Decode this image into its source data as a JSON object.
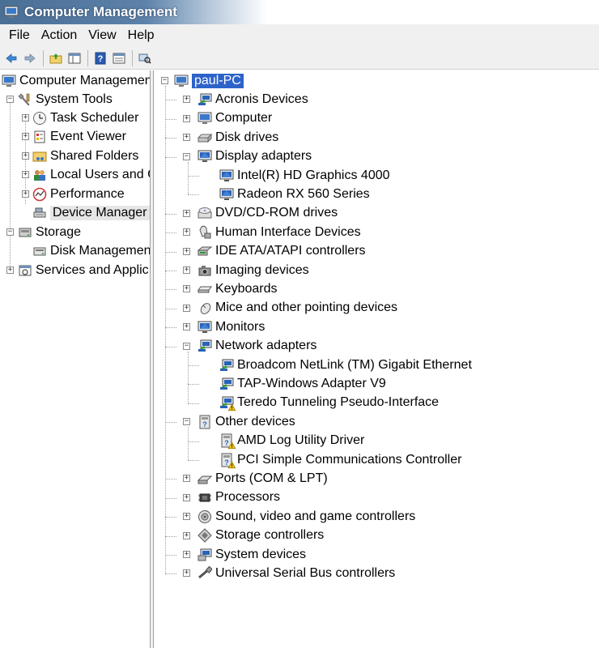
{
  "window": {
    "title": "Computer Management"
  },
  "menu": [
    "File",
    "Action",
    "View",
    "Help"
  ],
  "toolbar": {
    "buttons": [
      "back-icon",
      "forward-icon",
      "up-folder-icon",
      "show-hide-console-tree-icon",
      "help-icon",
      "properties-icon",
      "scan-hardware-icon"
    ]
  },
  "left_tree": {
    "root": "Computer Managemen",
    "system_tools": "System Tools",
    "task_scheduler": "Task Scheduler",
    "event_viewer": "Event Viewer",
    "shared_folders": "Shared Folders",
    "local_users": "Local Users and G",
    "performance": "Performance",
    "device_manager": "Device Manager",
    "storage": "Storage",
    "disk_management": "Disk Managemen",
    "services": "Services and Applic"
  },
  "device_tree": {
    "computer_name": "paul-PC",
    "categories": [
      {
        "label": "Acronis Devices",
        "expanded": false
      },
      {
        "label": "Computer",
        "expanded": false
      },
      {
        "label": "Disk drives",
        "expanded": false
      },
      {
        "label": "Display adapters",
        "expanded": true,
        "children": [
          "Intel(R) HD Graphics 4000",
          "Radeon RX 560 Series"
        ]
      },
      {
        "label": "DVD/CD-ROM drives",
        "expanded": false
      },
      {
        "label": "Human Interface Devices",
        "expanded": false
      },
      {
        "label": "IDE ATA/ATAPI controllers",
        "expanded": false
      },
      {
        "label": "Imaging devices",
        "expanded": false
      },
      {
        "label": "Keyboards",
        "expanded": false
      },
      {
        "label": "Mice and other pointing devices",
        "expanded": false
      },
      {
        "label": "Monitors",
        "expanded": false
      },
      {
        "label": "Network adapters",
        "expanded": true,
        "children": [
          "Broadcom NetLink (TM) Gigabit Ethernet",
          "TAP-Windows Adapter V9",
          "Teredo Tunneling Pseudo-Interface"
        ]
      },
      {
        "label": "Other devices",
        "expanded": true,
        "children": [
          "AMD Log Utility Driver",
          "PCI Simple Communications Controller"
        ]
      },
      {
        "label": "Ports (COM & LPT)",
        "expanded": false
      },
      {
        "label": "Processors",
        "expanded": false
      },
      {
        "label": "Sound, video and game controllers",
        "expanded": false
      },
      {
        "label": "Storage controllers",
        "expanded": false
      },
      {
        "label": "System devices",
        "expanded": false
      },
      {
        "label": "Universal Serial Bus controllers",
        "expanded": false
      }
    ]
  },
  "colors": {
    "selection_blue": "#2d63c9",
    "selection_gray": "#e6e6e6",
    "warning": "#f5c400"
  }
}
